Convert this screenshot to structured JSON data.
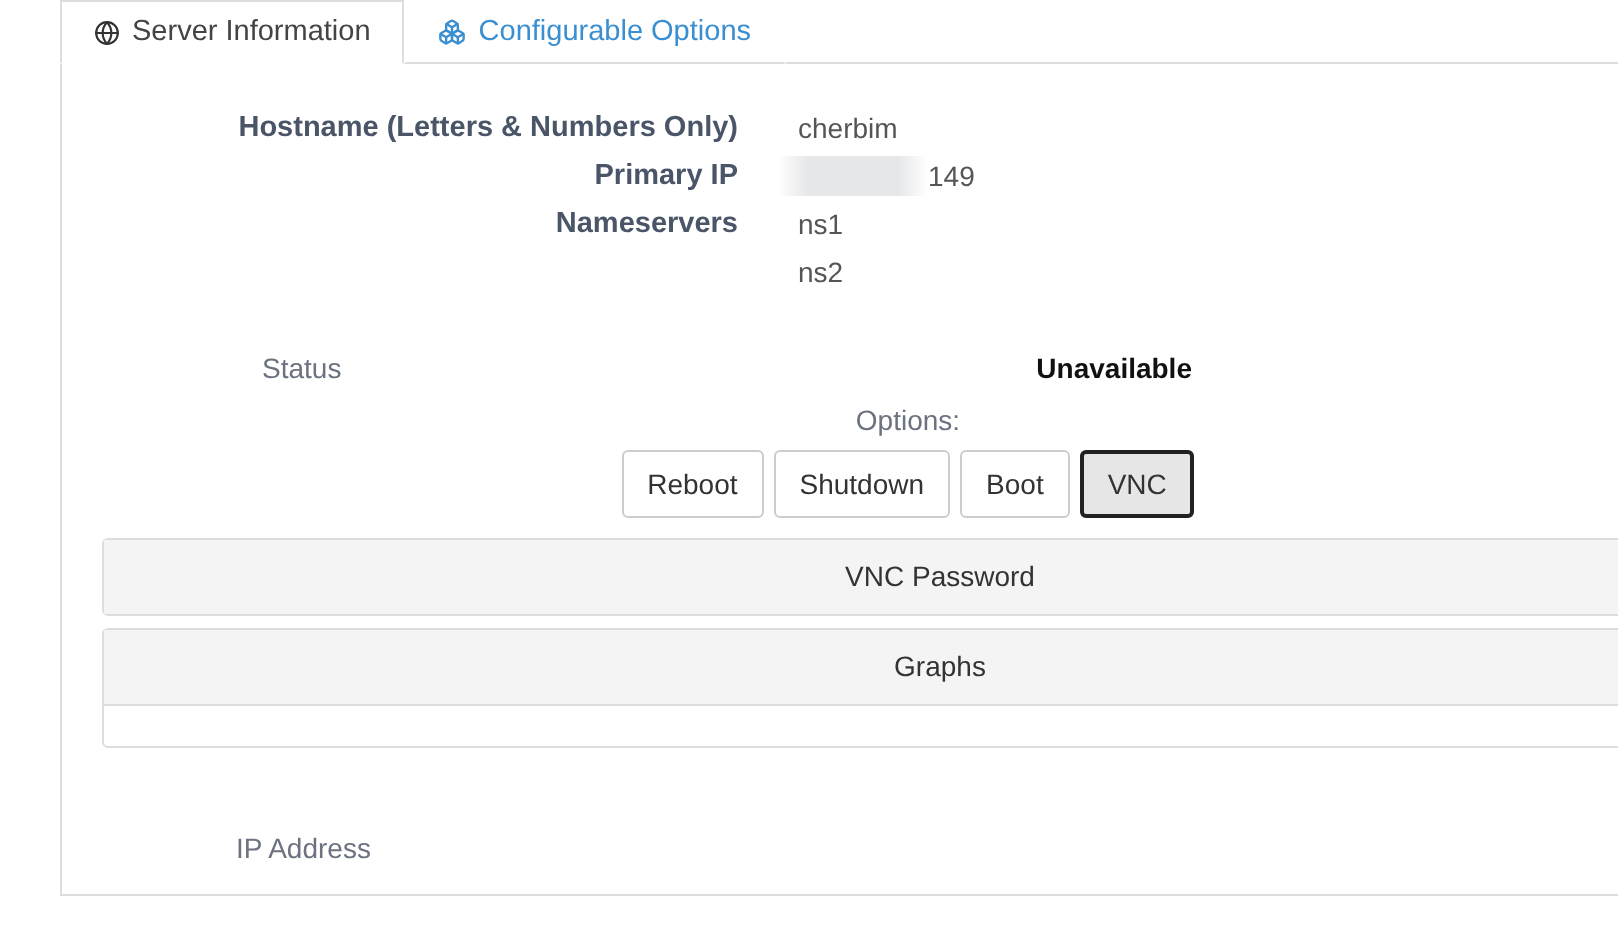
{
  "tabs": [
    {
      "label": "Server Information",
      "selected": true
    },
    {
      "label": "Configurable Options",
      "selected": false
    }
  ],
  "details": [
    {
      "label": "Hostname (Letters & Numbers Only)",
      "values": [
        "cherbim"
      ],
      "redacted": false
    },
    {
      "label": "Primary IP",
      "values": [
        "149"
      ],
      "redacted": true
    },
    {
      "label": "Nameservers",
      "values": [
        "ns1",
        "ns2"
      ],
      "redacted": false
    }
  ],
  "status": {
    "label": "Status",
    "value": "Unavailable"
  },
  "options": {
    "label": "Options:",
    "buttons": [
      {
        "label": "Reboot",
        "selected": false
      },
      {
        "label": "Shutdown",
        "selected": false
      },
      {
        "label": "Boot",
        "selected": false
      },
      {
        "label": "VNC",
        "selected": true
      }
    ]
  },
  "sections": [
    {
      "title": "VNC Password",
      "expanded": false
    },
    {
      "title": "Graphs",
      "expanded": true
    }
  ],
  "ip_label": "IP Address"
}
